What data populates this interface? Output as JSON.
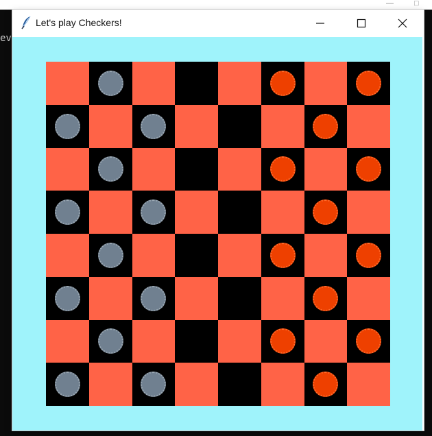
{
  "window": {
    "title": "Let's play Checkers!",
    "icon": "feather-icon",
    "buttons": {
      "minimize": "minimize-icon",
      "maximize": "maximize-icon",
      "close": "close-icon"
    }
  },
  "background_text": "eve",
  "colors": {
    "client_bg": "#9ff3fb",
    "light_square": "#ff6347",
    "dark_square": "#000000",
    "gray_piece": "#708090",
    "red_piece": "#ee4000"
  },
  "board": {
    "rows": 8,
    "cols": 8,
    "pieces": [
      [
        null,
        "gray",
        null,
        null,
        null,
        "red",
        null,
        "red"
      ],
      [
        "gray",
        null,
        "gray",
        null,
        null,
        null,
        "red",
        null
      ],
      [
        null,
        "gray",
        null,
        null,
        null,
        "red",
        null,
        "red"
      ],
      [
        "gray",
        null,
        "gray",
        null,
        null,
        null,
        "red",
        null
      ],
      [
        null,
        "gray",
        null,
        null,
        null,
        "red",
        null,
        "red"
      ],
      [
        "gray",
        null,
        "gray",
        null,
        null,
        null,
        "red",
        null
      ],
      [
        null,
        "gray",
        null,
        null,
        null,
        "red",
        null,
        "red"
      ],
      [
        "gray",
        null,
        "gray",
        null,
        null,
        null,
        "red",
        null
      ]
    ]
  }
}
